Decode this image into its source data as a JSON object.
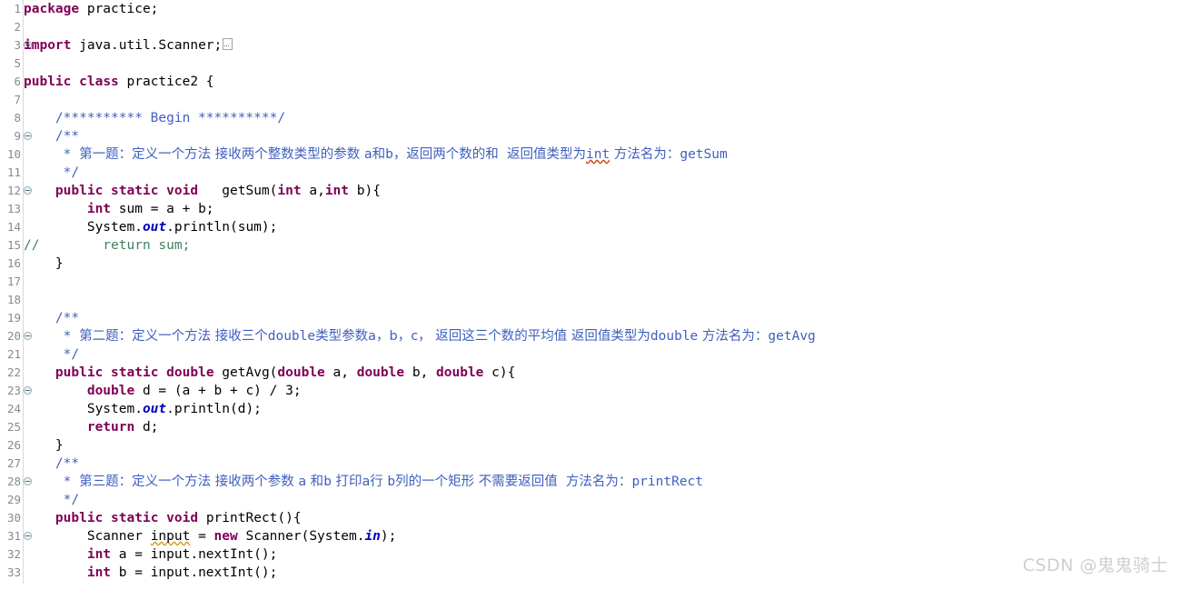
{
  "app": {
    "kind": "java-code-editor",
    "language": "Java",
    "theme": "eclipse-light"
  },
  "colors": {
    "background": "#ffffff",
    "keyword": "#7f0055",
    "javadoc_comment": "#3f5fbf",
    "line_comment": "#3f7f5f",
    "static_field": "#0000c0",
    "local_variable": "#6a3e2a",
    "plain_text": "#000000",
    "gutter_text": "#8a8a8a",
    "gutter_rule": "#d8d8d8",
    "spell_error_squiggle": "#c84a14",
    "warning_squiggle": "#d0a020",
    "watermark": "#cfcfcf"
  },
  "watermark": {
    "text": "CSDN @鬼鬼骑士"
  },
  "gutter": {
    "numbers": [
      "1",
      "2",
      "3",
      "5",
      "6",
      "7",
      "8",
      "9",
      "10",
      "11",
      "12",
      "13",
      "14",
      "15",
      "16",
      "17",
      "18",
      "19",
      "20",
      "21",
      "22",
      "23",
      "24",
      "25",
      "26",
      "27",
      "28",
      "29",
      "30",
      "31",
      "32",
      "33"
    ],
    "fold_markers": {
      "3": "plus",
      "9": "minus",
      "12": "minus",
      "19": "minus",
      "22": "minus",
      "27": "minus",
      "30": "minus"
    }
  },
  "code": {
    "lines": [
      {
        "n": "1",
        "text": "package practice;"
      },
      {
        "n": "2",
        "text": ""
      },
      {
        "n": "3",
        "text": "import java.util.Scanner;"
      },
      {
        "n": "5",
        "text": ""
      },
      {
        "n": "6",
        "text": "public class practice2 {"
      },
      {
        "n": "7",
        "text": ""
      },
      {
        "n": "8",
        "text": "    /********** Begin **********/"
      },
      {
        "n": "9",
        "text": "    /**"
      },
      {
        "n": "10",
        "text": "     * 第一题：定义一个方法 接收两个整数类型的参数 a和b，返回两个数的和  返回值类型为int 方法名为：getSum"
      },
      {
        "n": "11",
        "text": "     */"
      },
      {
        "n": "12",
        "text": "    public static void   getSum(int a,int b){"
      },
      {
        "n": "13",
        "text": "        int sum = a + b;"
      },
      {
        "n": "14",
        "text": "        System.out.println(sum);"
      },
      {
        "n": "15",
        "text": "//        return sum;"
      },
      {
        "n": "16",
        "text": "    }"
      },
      {
        "n": "17",
        "text": ""
      },
      {
        "n": "18",
        "text": ""
      },
      {
        "n": "19",
        "text": "    /**"
      },
      {
        "n": "20",
        "text": "     * 第二题：定义一个方法 接收三个double类型参数a，b，c， 返回这三个数的平均值 返回值类型为double 方法名为：getAvg"
      },
      {
        "n": "21",
        "text": "     */"
      },
      {
        "n": "22",
        "text": "    public static double getAvg(double a, double b, double c){"
      },
      {
        "n": "23",
        "text": "        double d = (a + b + c) / 3;"
      },
      {
        "n": "24",
        "text": "        System.out.println(d);"
      },
      {
        "n": "25",
        "text": "        return d;"
      },
      {
        "n": "26",
        "text": "    }"
      },
      {
        "n": "27",
        "text": "    /**"
      },
      {
        "n": "28",
        "text": "     * 第三题：定义一个方法 接收两个参数 a 和b 打印a行 b列的一个矩形 不需要返回值  方法名为：printRect"
      },
      {
        "n": "29",
        "text": "     */"
      },
      {
        "n": "30",
        "text": "    public static void printRect(){"
      },
      {
        "n": "31",
        "text": "        Scanner input = new Scanner(System.in);"
      },
      {
        "n": "32",
        "text": "        int a = input.nextInt();"
      },
      {
        "n": "33",
        "text": "        int b = input.nextInt();"
      }
    ],
    "tokens": {
      "line1": {
        "kw": "package",
        "rest": " practice;"
      },
      "line3": {
        "kw": "import",
        "rest": " java.util.Scanner;"
      },
      "line6": {
        "kw1": "public",
        "kw2": "class",
        "name": " practice2 {"
      },
      "line8": {
        "comment": "/********** Begin **********/"
      },
      "line10": {
        "marker": "* ",
        "t1": "第一题：定义一个方法 接收两个整数类型的参数 ",
        "t2": "a和b",
        "t3": "，返回两个数的和  返回值类型为",
        "t4": "int",
        "t5": " 方法名为：",
        "t6": "getSum"
      },
      "line12": {
        "kw1": "public",
        "kw2": "static",
        "kw3": "void",
        "sig1": "   getSum(",
        "kw4": "int",
        "p1": " a,",
        "kw5": "int",
        "p2": " b){"
      },
      "line13": {
        "kw": "int",
        "rest": " sum = a + b;"
      },
      "line14": {
        "a": "System.",
        "field": "out",
        "b": ".println(sum);"
      },
      "line15": {
        "comment": "//        return sum;"
      },
      "line20": {
        "marker": "* ",
        "t1": "第二题：定义一个方法 接收三个",
        "t2": "double",
        "t3": "类型参数a，b，c， 返回这三个数的平均值 返回值类型为",
        "t4": "double",
        "t5": " 方法名为：",
        "t6": "getAvg"
      },
      "line22": {
        "kw1": "public",
        "kw2": "static",
        "kw3": "double",
        "n1": " getAvg(",
        "kw4": "double",
        "p1": " a, ",
        "kw5": "double",
        "p2": " b, ",
        "kw6": "double",
        "p3": " c){"
      },
      "line23": {
        "kw": "double",
        "rest": " d = (a + b + c) / 3;"
      },
      "line24": {
        "a": "System.",
        "field": "out",
        "b": ".println(d);"
      },
      "line25": {
        "kw": "return",
        "rest": " d;"
      },
      "line28": {
        "marker": "* ",
        "t1": "第三题：定义一个方法 接收两个参数 ",
        "t2": "a",
        "t3": " 和",
        "t4": "b",
        "t5": " 打印",
        "t6": "a",
        "t7": "行 ",
        "t8": "b",
        "t9": "列的一个矩形 不需要返回值  方法名为：",
        "t10": "printRect"
      },
      "line30": {
        "kw1": "public",
        "kw2": "static",
        "kw3": "void",
        "n1": " printRect(){"
      },
      "line31": {
        "a": "Scanner ",
        "v": "input",
        "b": " = ",
        "kw": "new",
        "c": " Scanner(System.",
        "field": "in",
        "d": ");"
      },
      "line32": {
        "kw": "int",
        "rest": " a = input.nextInt();"
      },
      "line33": {
        "kw": "int",
        "rest": " b = input.nextInt();"
      }
    }
  }
}
